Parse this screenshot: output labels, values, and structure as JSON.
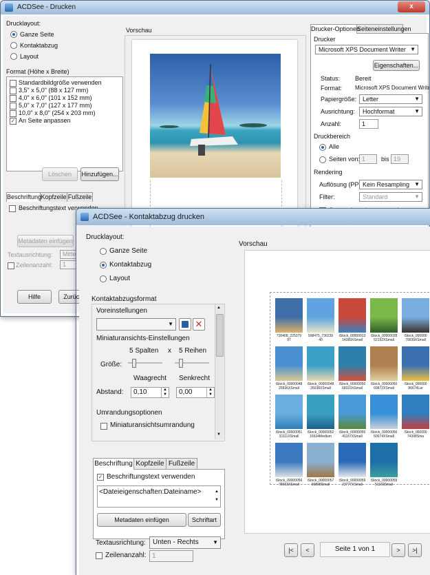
{
  "back_window": {
    "title": "ACDSee - Drucken",
    "close_label": "x",
    "layout_group": "Drucklayout:",
    "layout_options": [
      "Ganze Seite",
      "Kontaktabzug",
      "Layout"
    ],
    "format_group": "Format (Höhe x Breite)",
    "format_items": [
      "Standardbildgröße verwenden",
      "3,5\" x 5,0\" (88 x 127 mm)",
      "4,0\" x 6,0\" (101 x 152 mm)",
      "5,0\" x 7,0\" (127 x 177 mm)",
      "10,0\" x 8,0\" (254 x 203 mm)",
      "An Seite anpassen"
    ],
    "delete_button": "Löschen",
    "add_button": "Hinzufügen...",
    "tabs": [
      "Beschriftung",
      "Kopfzeile",
      "Fußzeile"
    ],
    "caption_check": "Beschriftungstext verwenden",
    "metadata_button": "Metadaten einfügen",
    "text_align_label": "Textausrichtung:",
    "text_align_value": "Mitte",
    "line_count_label": "Zeilenanzahl:",
    "line_count_value": "1",
    "help_button": "Hilfe",
    "back_button": "Zurück",
    "preview_label": "Vorschau",
    "right_tabs": [
      "Drucker-Optionen",
      "Seiteneinstellungen"
    ],
    "printer_group": "Drucker",
    "printer_value": "Microsoft XPS Document Writer",
    "properties_button": "Eigenschaften...",
    "status_label": "Status:",
    "status_value": "Bereit",
    "format_label": "Format:",
    "format_value": "Microsoft XPS Document Writer",
    "paper_label": "Papiergröße:",
    "paper_value": "Letter",
    "orientation_label": "Ausrichtung:",
    "orientation_value": "Hochformat",
    "copies_label": "Anzahl:",
    "copies_value": "1",
    "range_group": "Druckbereich",
    "range_all": "Alle",
    "range_pages": "Seiten von:",
    "range_from": "1",
    "range_to_label": "bis",
    "range_to": "19",
    "rendering_group": "Rendering",
    "resolution_label": "Auflösung (PPI):",
    "resolution_value": "Kein Resampling",
    "filter_label": "Filter:",
    "filter_value": "Standard",
    "gamma_check": "Gammakorrektur anwenden:"
  },
  "front_window": {
    "title": "ACDSee - Kontaktabzug drucken",
    "layout_group": "Drucklayout:",
    "layout_options": [
      "Ganze Seite",
      "Kontaktabzug",
      "Layout"
    ],
    "contact_group": "Kontaktabzugsformat",
    "presets_label": "Voreinstellungen",
    "thumb_settings": "Miniaturansichts-Einstellungen",
    "size_label": "Größe:",
    "columns_text": "5 Spalten",
    "times": "x",
    "rows_text": "5 Reihen",
    "spacing_label": "Abstand:",
    "horizontal_label": "Waagrecht",
    "vertical_label": "Senkrecht",
    "horizontal_value": "0,10",
    "vertical_value": "0,00",
    "border_group": "Umrandungsoptionen",
    "border_check": "Miniaturansichtsumrandung",
    "tabs": [
      "Beschriftung",
      "Kopfzeile",
      "Fußzeile"
    ],
    "caption_check": "Beschriftungstext verwenden",
    "caption_text": "<Dateieigenschaften:Dateiname>",
    "metadata_button": "Metadaten einfügen",
    "font_button": "Schriftart",
    "text_align_label": "Textausrichtung:",
    "text_align_value": "Unten - Rechts",
    "line_count_label": "Zeilenanzahl:",
    "line_count_value": "1",
    "preview_label": "Vorschau",
    "page_text": "Seite 1 von 1",
    "thumbnails": [
      {
        "label": "730408_225379 97",
        "c1": "#3f6fa8",
        "c2": "#dcb46a"
      },
      {
        "label": "998475_736239 40",
        "c1": "#5fa4e0",
        "c2": "#e8e4c8"
      },
      {
        "label": "iStock_00000013 14389XSmall",
        "c1": "#c8483c",
        "c2": "#3b80c0"
      },
      {
        "label": "iStock_00000028 52152XSmall",
        "c1": "#7ab84a",
        "c2": "#2d5d2a"
      },
      {
        "label": "iStock_000000 79939XSmall",
        "c1": "#7aaee0",
        "c2": "#3c3028"
      },
      {
        "label": "iStock_00000048 25836XSmall",
        "c1": "#4a90d0",
        "c2": "#dcc890"
      },
      {
        "label": "iStock_00000048 26038XSmall",
        "c1": "#3ca0c8",
        "c2": "#e8d8b0"
      },
      {
        "label": "iStock_00000050 68323XSmall",
        "c1": "#2c7fa8",
        "c2": "#d8503c"
      },
      {
        "label": "iStock_00000050 69872XSmall",
        "c1": "#b08050",
        "c2": "#e0d0a0"
      },
      {
        "label": "iStock_000000 86674Lar",
        "c1": "#3a70b0",
        "c2": "#f0c040"
      },
      {
        "label": "iStock_00000051 31111XSmall",
        "c1": "#6aaee0",
        "c2": "#2d7fb8"
      },
      {
        "label": "iStock_00000052 16634Medium",
        "c1": "#3aa0c0",
        "c2": "#1e5f8a"
      },
      {
        "label": "iStock_00000055 41157XSmall",
        "c1": "#4a9ad8",
        "c2": "#5a8a3a"
      },
      {
        "label": "iStock_00000056 50074XSmall",
        "c1": "#3890d8",
        "c2": "#c8d0d8"
      },
      {
        "label": "iStock_000000 74398Sma",
        "c1": "#2f7fc0",
        "c2": "#c83c3c"
      },
      {
        "label": "iStock_00000056 78653XSmall",
        "c1": "#3a78c0",
        "c2": "#e0e0e0"
      },
      {
        "label": "iStock_00000057 90808Small",
        "c1": "#8ab0d0",
        "c2": "#a07848"
      },
      {
        "label": "iStock_00000059 23777XSmall",
        "c1": "#2a6ab8",
        "c2": "#e8e8e8"
      },
      {
        "label": "iStock_00000059 51160Small",
        "c1": "#1e6ea8",
        "c2": "#3aa0a0"
      }
    ]
  }
}
